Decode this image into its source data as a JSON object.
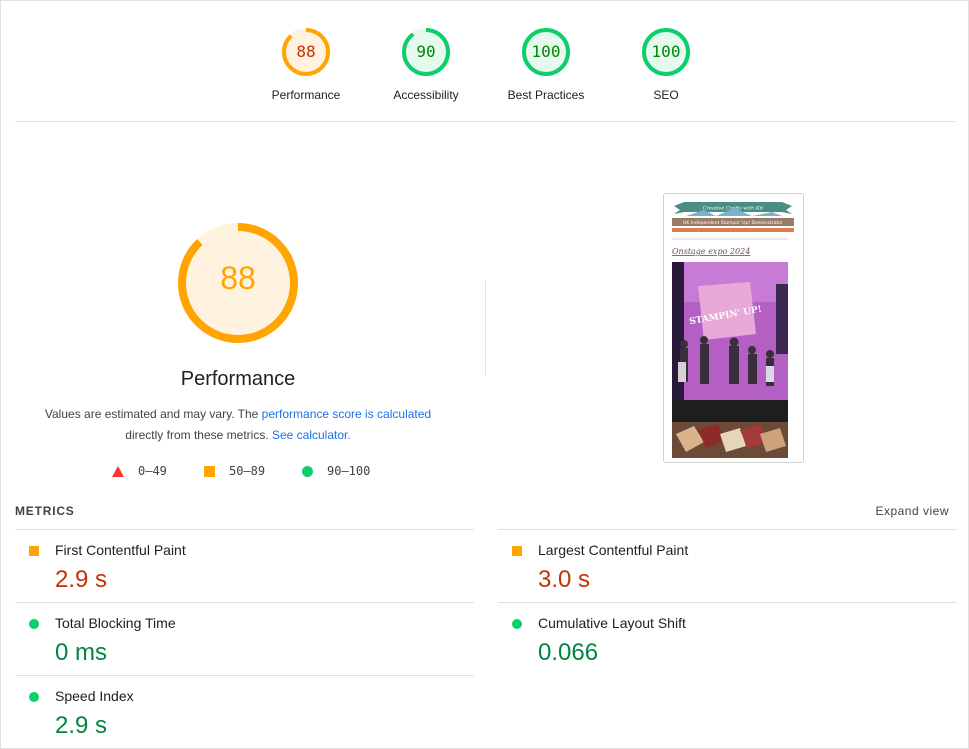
{
  "gauges": [
    {
      "score": "88",
      "label": "Performance",
      "status": "average"
    },
    {
      "score": "90",
      "label": "Accessibility",
      "status": "pass"
    },
    {
      "score": "100",
      "label": "Best Practices",
      "status": "pass"
    },
    {
      "score": "100",
      "label": "SEO",
      "status": "pass"
    }
  ],
  "performance": {
    "score": "88",
    "title": "Performance",
    "desc_prefix": "Values are estimated and may vary. The ",
    "desc_link1": "performance score is calculated",
    "desc_middle": "directly from these metrics. ",
    "desc_link2": "See calculator."
  },
  "legend": {
    "fail": "0–49",
    "average": "50–89",
    "pass": "90–100"
  },
  "screenshot": {
    "banner_text": "Creative Crafts with Kit",
    "subtitle": "UK Independent Stampin' Up! Demonstrator",
    "post_title": "Onstage expo 2024",
    "stage_sign": "STAMPIN' UP!"
  },
  "metrics": {
    "heading": "METRICS",
    "expand_label": "Expand view",
    "items": [
      {
        "name": "First Contentful Paint",
        "value": "2.9 s",
        "status": "average"
      },
      {
        "name": "Largest Contentful Paint",
        "value": "3.0 s",
        "status": "average"
      },
      {
        "name": "Total Blocking Time",
        "value": "0 ms",
        "status": "pass"
      },
      {
        "name": "Cumulative Layout Shift",
        "value": "0.066",
        "status": "pass"
      },
      {
        "name": "Speed Index",
        "value": "2.9 s",
        "status": "pass"
      }
    ]
  },
  "colors": {
    "average": "#ffa400",
    "average_text": "#c33300",
    "pass": "#0cce6b",
    "pass_text": "#008800",
    "fail": "#ff3333",
    "link": "#1a73e8"
  }
}
